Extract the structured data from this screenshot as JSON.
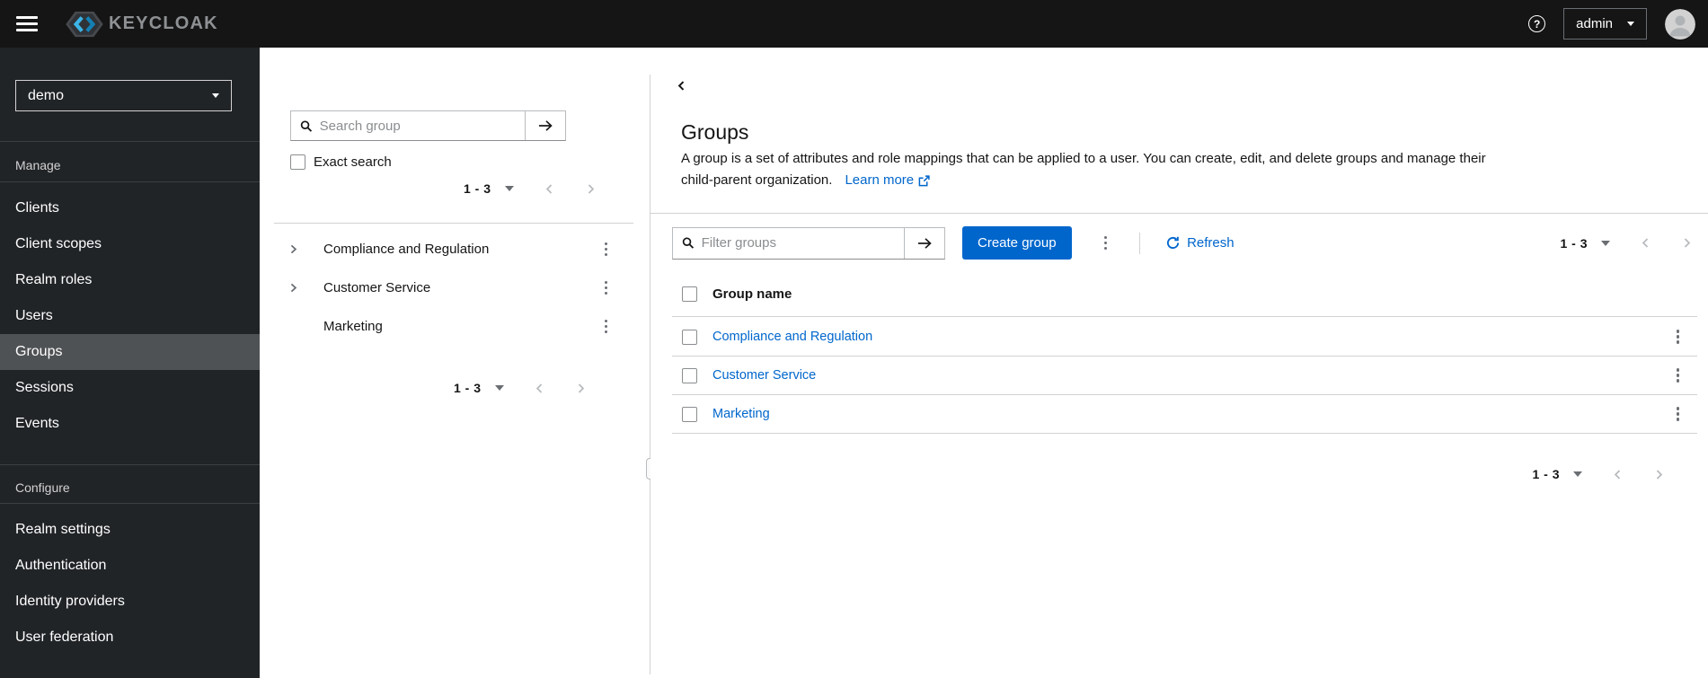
{
  "topbar": {
    "brand": "KEYCLOAK",
    "user": "admin"
  },
  "sidebar": {
    "realm": "demo",
    "sections": [
      {
        "label": "Manage",
        "items": [
          {
            "label": "Clients",
            "active": false
          },
          {
            "label": "Client scopes",
            "active": false
          },
          {
            "label": "Realm roles",
            "active": false
          },
          {
            "label": "Users",
            "active": false
          },
          {
            "label": "Groups",
            "active": true
          },
          {
            "label": "Sessions",
            "active": false
          },
          {
            "label": "Events",
            "active": false
          }
        ]
      },
      {
        "label": "Configure",
        "items": [
          {
            "label": "Realm settings",
            "active": false
          },
          {
            "label": "Authentication",
            "active": false
          },
          {
            "label": "Identity providers",
            "active": false
          },
          {
            "label": "User federation",
            "active": false
          }
        ]
      }
    ]
  },
  "drawer": {
    "search_placeholder": "Search group",
    "exact_search_label": "Exact search",
    "exact_search_checked": false,
    "pagination": {
      "range": "1 - 3"
    },
    "tree": [
      {
        "label": "Compliance and Regulation",
        "expandable": true
      },
      {
        "label": "Customer Service",
        "expandable": true
      },
      {
        "label": "Marketing",
        "expandable": false
      }
    ]
  },
  "main": {
    "title": "Groups",
    "description": {
      "line1": "A group is a set of attributes and role mappings that can be applied to a user. You can create, edit, and delete groups and manage their",
      "line2": "child-parent organization.",
      "learn_more_label": "Learn more"
    },
    "toolbar": {
      "filter_placeholder": "Filter groups",
      "create_label": "Create group",
      "refresh_label": "Refresh",
      "pagination": {
        "range": "1 - 3"
      }
    },
    "table": {
      "header": "Group name",
      "rows": [
        {
          "name": "Compliance and Regulation"
        },
        {
          "name": "Customer Service"
        },
        {
          "name": "Marketing"
        }
      ],
      "all_checked": false
    },
    "bottom_pagination": {
      "range": "1 - 3"
    }
  },
  "colors": {
    "primary": "#0066cc",
    "link": "#0066cc",
    "masthead_bg": "#151515",
    "sidebar_bg": "#212427",
    "sidebar_active_bg": "#4f5255",
    "border": "#d2d2d2",
    "muted_icon": "#6a6e73",
    "disabled_chevron": "#b8bbbe"
  },
  "icons": {
    "menu": "hamburger-bars",
    "brand": "keycloak-hexagon-chevrons",
    "help": "question-circle",
    "user": "avatar-person",
    "select_caret": "caret-down",
    "search": "magnifier",
    "submit_search": "arrow-right",
    "pagination_menu": "caret-down",
    "prev": "angle-left",
    "next": "angle-right",
    "tree_expand": "angle-right",
    "row_actions": "kebab-vertical-dots",
    "refresh": "sync-circular-arrow",
    "learn_more": "external-link",
    "collapse_drawer": "angle-left",
    "panel_resize": "drag-handle"
  }
}
